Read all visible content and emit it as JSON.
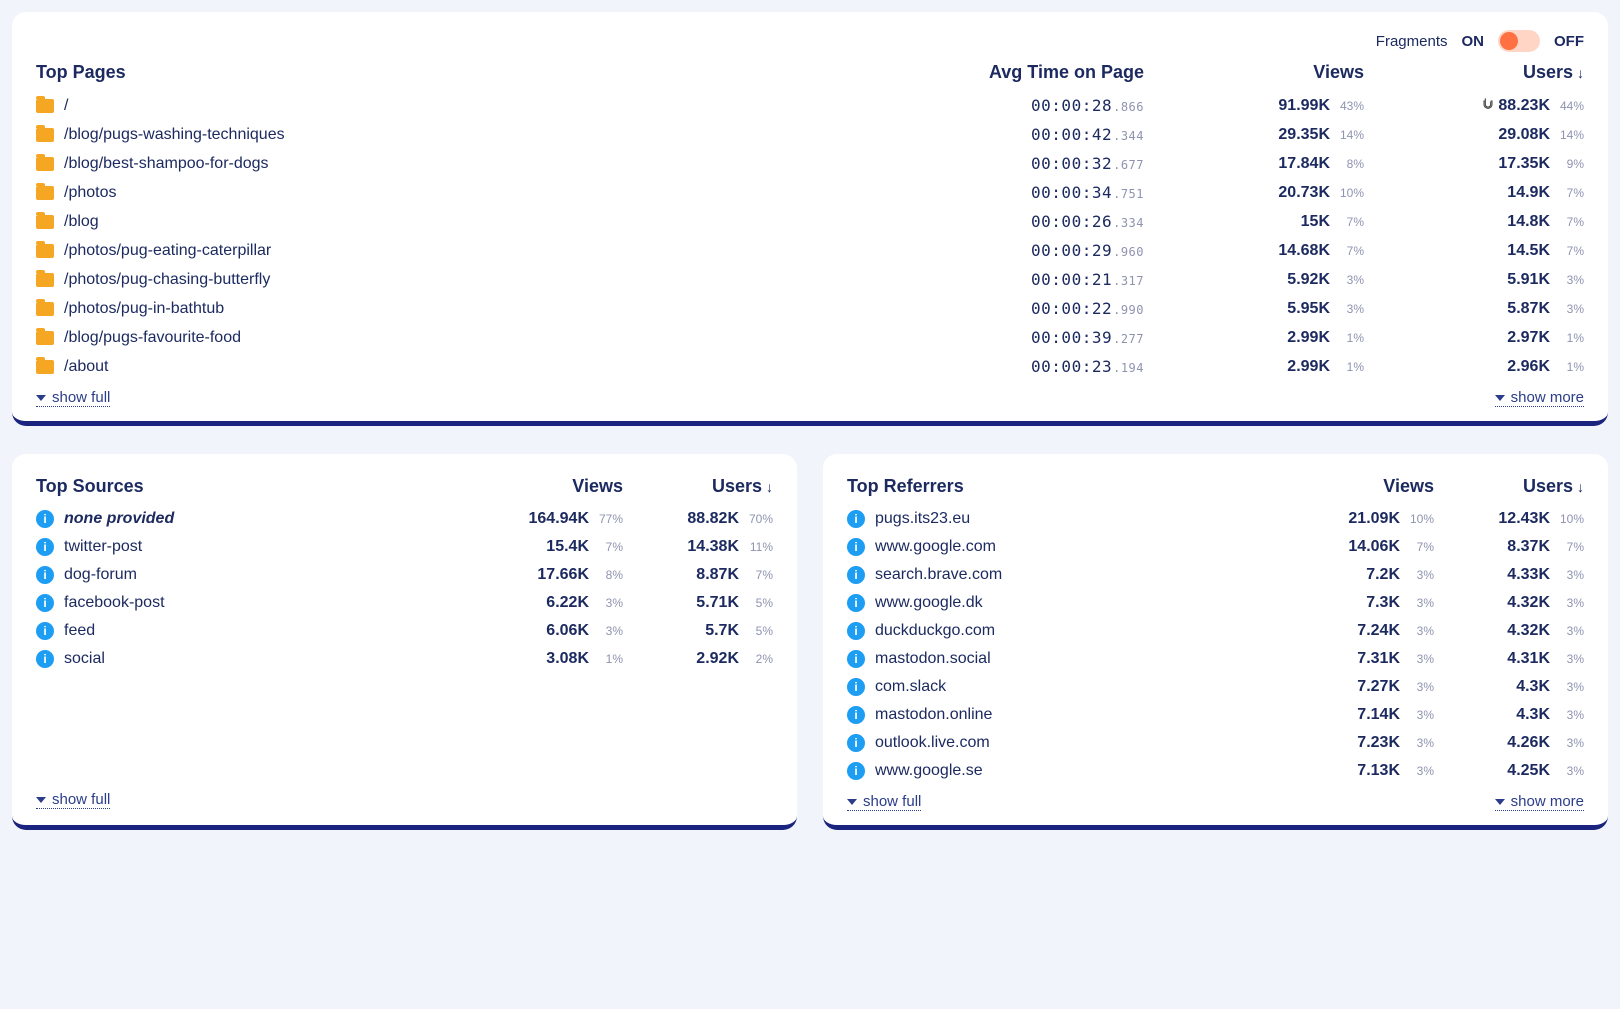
{
  "fragments": {
    "label": "Fragments",
    "on": "ON",
    "off": "OFF",
    "state": "on"
  },
  "pages": {
    "title": "Top Pages",
    "col_time": "Avg Time on Page",
    "col_views": "Views",
    "col_users": "Users",
    "sort_indicator": "↓",
    "rows": [
      {
        "path": "/",
        "time_main": "00:00:28",
        "time_sub": ".866",
        "views": "91.99K",
        "views_pct": "43%",
        "users": "88.23K",
        "users_pct": "44%"
      },
      {
        "path": "/blog/pugs-washing-techniques",
        "time_main": "00:00:42",
        "time_sub": ".344",
        "views": "29.35K",
        "views_pct": "14%",
        "users": "29.08K",
        "users_pct": "14%"
      },
      {
        "path": "/blog/best-shampoo-for-dogs",
        "time_main": "00:00:32",
        "time_sub": ".677",
        "views": "17.84K",
        "views_pct": "8%",
        "users": "17.35K",
        "users_pct": "9%"
      },
      {
        "path": "/photos",
        "time_main": "00:00:34",
        "time_sub": ".751",
        "views": "20.73K",
        "views_pct": "10%",
        "users": "14.9K",
        "users_pct": "7%"
      },
      {
        "path": "/blog",
        "time_main": "00:00:26",
        "time_sub": ".334",
        "views": "15K",
        "views_pct": "7%",
        "users": "14.8K",
        "users_pct": "7%"
      },
      {
        "path": "/photos/pug-eating-caterpillar",
        "time_main": "00:00:29",
        "time_sub": ".960",
        "views": "14.68K",
        "views_pct": "7%",
        "users": "14.5K",
        "users_pct": "7%"
      },
      {
        "path": "/photos/pug-chasing-butterfly",
        "time_main": "00:00:21",
        "time_sub": ".317",
        "views": "5.92K",
        "views_pct": "3%",
        "users": "5.91K",
        "users_pct": "3%"
      },
      {
        "path": "/photos/pug-in-bathtub",
        "time_main": "00:00:22",
        "time_sub": ".990",
        "views": "5.95K",
        "views_pct": "3%",
        "users": "5.87K",
        "users_pct": "3%"
      },
      {
        "path": "/blog/pugs-favourite-food",
        "time_main": "00:00:39",
        "time_sub": ".277",
        "views": "2.99K",
        "views_pct": "1%",
        "users": "2.97K",
        "users_pct": "1%"
      },
      {
        "path": "/about",
        "time_main": "00:00:23",
        "time_sub": ".194",
        "views": "2.99K",
        "views_pct": "1%",
        "users": "2.96K",
        "users_pct": "1%"
      }
    ],
    "show_full": "show full",
    "show_more": "show more"
  },
  "sources": {
    "title": "Top Sources",
    "col_views": "Views",
    "col_users": "Users",
    "sort_indicator": "↓",
    "rows": [
      {
        "name": "none provided",
        "italic": true,
        "views": "164.94K",
        "views_pct": "77%",
        "users": "88.82K",
        "users_pct": "70%"
      },
      {
        "name": "twitter-post",
        "views": "15.4K",
        "views_pct": "7%",
        "users": "14.38K",
        "users_pct": "11%"
      },
      {
        "name": "dog-forum",
        "views": "17.66K",
        "views_pct": "8%",
        "users": "8.87K",
        "users_pct": "7%"
      },
      {
        "name": "facebook-post",
        "views": "6.22K",
        "views_pct": "3%",
        "users": "5.71K",
        "users_pct": "5%"
      },
      {
        "name": "feed",
        "views": "6.06K",
        "views_pct": "3%",
        "users": "5.7K",
        "users_pct": "5%"
      },
      {
        "name": "social",
        "views": "3.08K",
        "views_pct": "1%",
        "users": "2.92K",
        "users_pct": "2%"
      }
    ],
    "show_full": "show full"
  },
  "referrers": {
    "title": "Top Referrers",
    "col_views": "Views",
    "col_users": "Users",
    "sort_indicator": "↓",
    "rows": [
      {
        "name": "pugs.its23.eu",
        "views": "21.09K",
        "views_pct": "10%",
        "users": "12.43K",
        "users_pct": "10%"
      },
      {
        "name": "www.google.com",
        "views": "14.06K",
        "views_pct": "7%",
        "users": "8.37K",
        "users_pct": "7%"
      },
      {
        "name": "search.brave.com",
        "views": "7.2K",
        "views_pct": "3%",
        "users": "4.33K",
        "users_pct": "3%"
      },
      {
        "name": "www.google.dk",
        "views": "7.3K",
        "views_pct": "3%",
        "users": "4.32K",
        "users_pct": "3%"
      },
      {
        "name": "duckduckgo.com",
        "views": "7.24K",
        "views_pct": "3%",
        "users": "4.32K",
        "users_pct": "3%"
      },
      {
        "name": "mastodon.social",
        "views": "7.31K",
        "views_pct": "3%",
        "users": "4.31K",
        "users_pct": "3%"
      },
      {
        "name": "com.slack",
        "views": "7.27K",
        "views_pct": "3%",
        "users": "4.3K",
        "users_pct": "3%"
      },
      {
        "name": "mastodon.online",
        "views": "7.14K",
        "views_pct": "3%",
        "users": "4.3K",
        "users_pct": "3%"
      },
      {
        "name": "outlook.live.com",
        "views": "7.23K",
        "views_pct": "3%",
        "users": "4.26K",
        "users_pct": "3%"
      },
      {
        "name": "www.google.se",
        "views": "7.13K",
        "views_pct": "3%",
        "users": "4.25K",
        "users_pct": "3%"
      }
    ],
    "show_full": "show full",
    "show_more": "show more"
  }
}
